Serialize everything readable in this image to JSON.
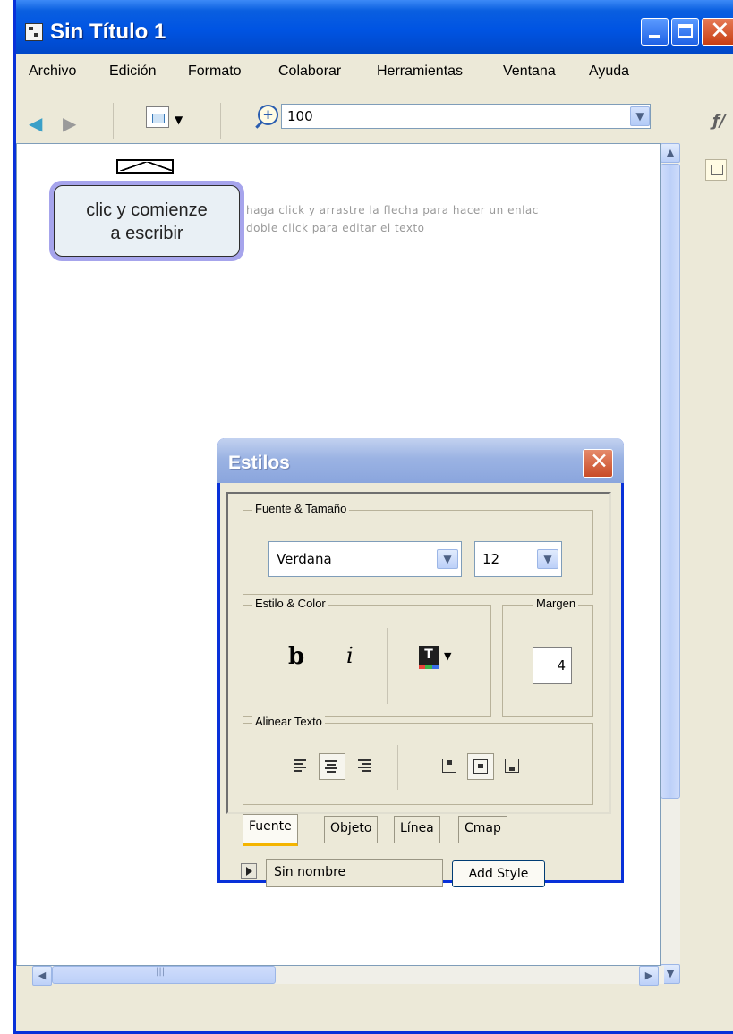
{
  "window": {
    "title": "Sin Título 1",
    "icon": "cmap-app-icon"
  },
  "menu": [
    "Archivo",
    "Edición",
    "Formato",
    "Colaborar",
    "Herramientas",
    "Ventana",
    "Ayuda"
  ],
  "toolbar": {
    "zoom_value": "100"
  },
  "canvas": {
    "node_text": "clic y comienze\na escribir",
    "hint_line1": "haga click y arrastre la flecha para hacer un enlac",
    "hint_line2": "doble click para editar el texto"
  },
  "styles_dialog": {
    "title": "Estilos",
    "font_group_label": "Fuente & Tamaño",
    "font_family": "Verdana",
    "font_size": "12",
    "style_group_label": "Estilo & Color",
    "bold_label": "b",
    "italic_label": "i",
    "margin_group_label": "Margen",
    "margin_value": "4",
    "align_group_label": "Alinear Texto",
    "tabs": [
      "Fuente",
      "Objeto",
      "Línea",
      "Cmap"
    ],
    "active_tab": "Fuente",
    "style_name": "Sin nombre",
    "add_style_label": "Add Style"
  },
  "colors": {
    "titlebar": "#0054e3",
    "node_border": "#a6a4ec",
    "node_fill": "#e9f0f5"
  }
}
